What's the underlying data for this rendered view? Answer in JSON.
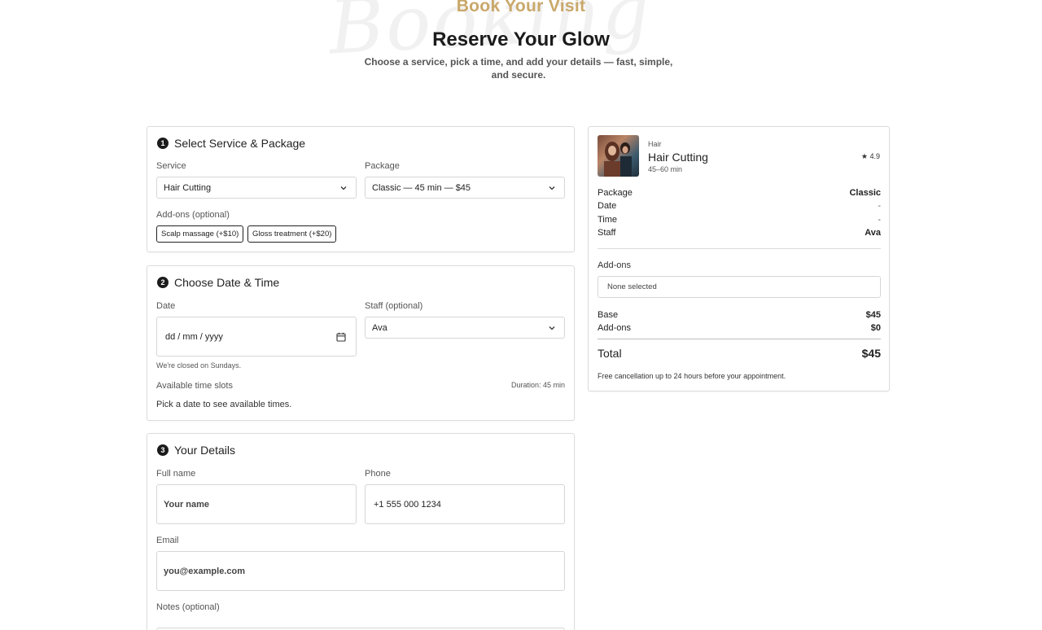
{
  "hero": {
    "watermark": "Booking",
    "eyebrow": "Book Your Visit",
    "title": "Reserve Your Glow",
    "subtitle": "Choose a service, pick a time, and add your details — fast, simple, and secure."
  },
  "step1": {
    "number": "1",
    "title": "Select Service & Package",
    "service_label": "Service",
    "service_value": "Hair Cutting",
    "package_label": "Package",
    "package_value": "Classic — 45 min — $45",
    "addons_label": "Add-ons (optional)",
    "addons": [
      "Scalp massage (+$10)",
      "Gloss treatment (+$20)"
    ]
  },
  "step2": {
    "number": "2",
    "title": "Choose Date & Time",
    "date_label": "Date",
    "date_placeholder": "dd / mm / yyyy",
    "staff_label": "Staff (optional)",
    "staff_value": "Ava",
    "closed_note": "We're closed on Sundays.",
    "slots_label": "Available time slots",
    "duration": "Duration: 45 min",
    "slots_hint": "Pick a date to see available times."
  },
  "step3": {
    "number": "3",
    "title": "Your Details",
    "name_label": "Full name",
    "name_placeholder": "Your name",
    "phone_label": "Phone",
    "phone_placeholder": "+1 555 000 1234",
    "email_label": "Email",
    "email_placeholder": "you@example.com",
    "notes_label": "Notes (optional)"
  },
  "summary": {
    "category": "Hair",
    "service": "Hair Cutting",
    "duration": "45–60 min",
    "rating": "★ 4.9",
    "rows": [
      {
        "label": "Package",
        "value": "Classic"
      },
      {
        "label": "Date",
        "value": "-"
      },
      {
        "label": "Time",
        "value": "-"
      },
      {
        "label": "Staff",
        "value": "Ava"
      }
    ],
    "addons_label": "Add-ons",
    "addons_value": "None selected",
    "base_label": "Base",
    "base_value": "$45",
    "addons_cost_label": "Add-ons",
    "addons_cost_value": "$0",
    "total_label": "Total",
    "total_value": "$45",
    "policy": "Free cancellation up to 24 hours before your appointment."
  },
  "colors": {
    "accent_gold": "#c9a86a",
    "text_dark": "#1b1b1b",
    "border": "#dcdcdc"
  }
}
